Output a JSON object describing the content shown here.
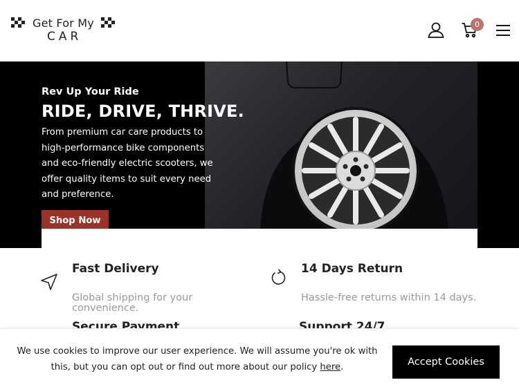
{
  "header": {
    "logo": {
      "line1": "Get For My",
      "line2": "CAR"
    },
    "cart_count": "0",
    "icons": {
      "user": "user-icon",
      "cart": "cart-icon",
      "menu": "hamburger-menu-icon"
    }
  },
  "hero": {
    "eyebrow": "Rev Up Your Ride",
    "headline": "RIDE, DRIVE, THRIVE.",
    "body": "From premium car care products to high-performance bike components and eco-friendly electric scooters, we offer quality items to suit every need and preference.",
    "button_label": "Shop Now",
    "image": "car-wheel-image"
  },
  "features": [
    {
      "title": "Fast Delivery",
      "desc": "Global shipping for your convenience.",
      "icon": "navigation-arrow-icon"
    },
    {
      "title": "14 Days Return",
      "desc": "Hassle-free returns within 14 days.",
      "icon": "return-cycle-icon"
    },
    {
      "title": "Secure Payment",
      "desc": "",
      "icon": "secure-payment-icon"
    },
    {
      "title": "Support 24/7",
      "desc": "",
      "icon": "support-icon"
    }
  ],
  "cookie": {
    "text_before": "We use cookies to improve our user experience. We will assume you're ok with this, but you can opt out or find out more about our policy ",
    "link": "here",
    "text_after": ".",
    "button_label": "Accept Cookies"
  },
  "colors": {
    "brand_red": "#9b3328",
    "badge": "#b5776e",
    "hero_bg": "#000000",
    "muted_text": "#999999"
  }
}
